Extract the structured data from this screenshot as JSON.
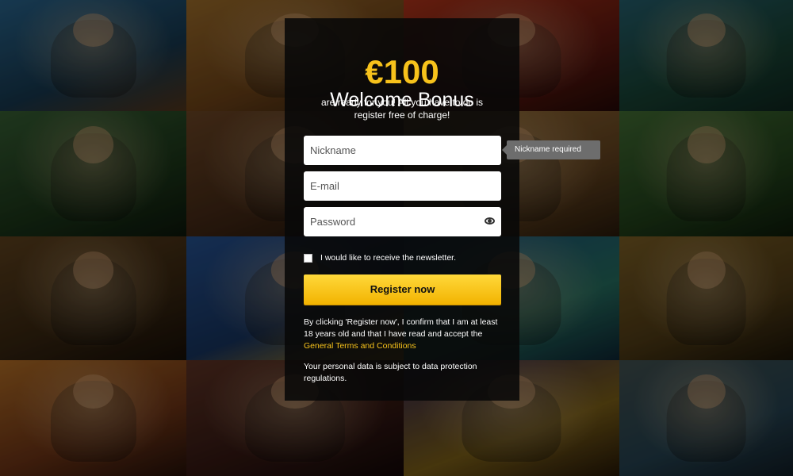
{
  "promo": {
    "amount": "€100",
    "title": "Welcome Bonus",
    "subtitle": "are ready for you! All you have to do is register free of charge!"
  },
  "form": {
    "nickname_placeholder": "Nickname",
    "email_placeholder": "E-mail",
    "password_placeholder": "Password",
    "nickname_error": "Nickname required",
    "newsletter_label": "I would like to receive the newsletter.",
    "register_label": "Register now"
  },
  "legal": {
    "text_before_link": "By clicking 'Register now', I confirm that I am at least 18 years old and that I have read and accept the ",
    "terms_link": "General Terms and Conditions",
    "privacy": "Your personal data is subject to data protection regulations."
  },
  "icons": {
    "password_toggle": "eye-icon"
  },
  "colors": {
    "accent": "#f7c21b",
    "button": "#ffd02a",
    "panel": "#080808"
  }
}
